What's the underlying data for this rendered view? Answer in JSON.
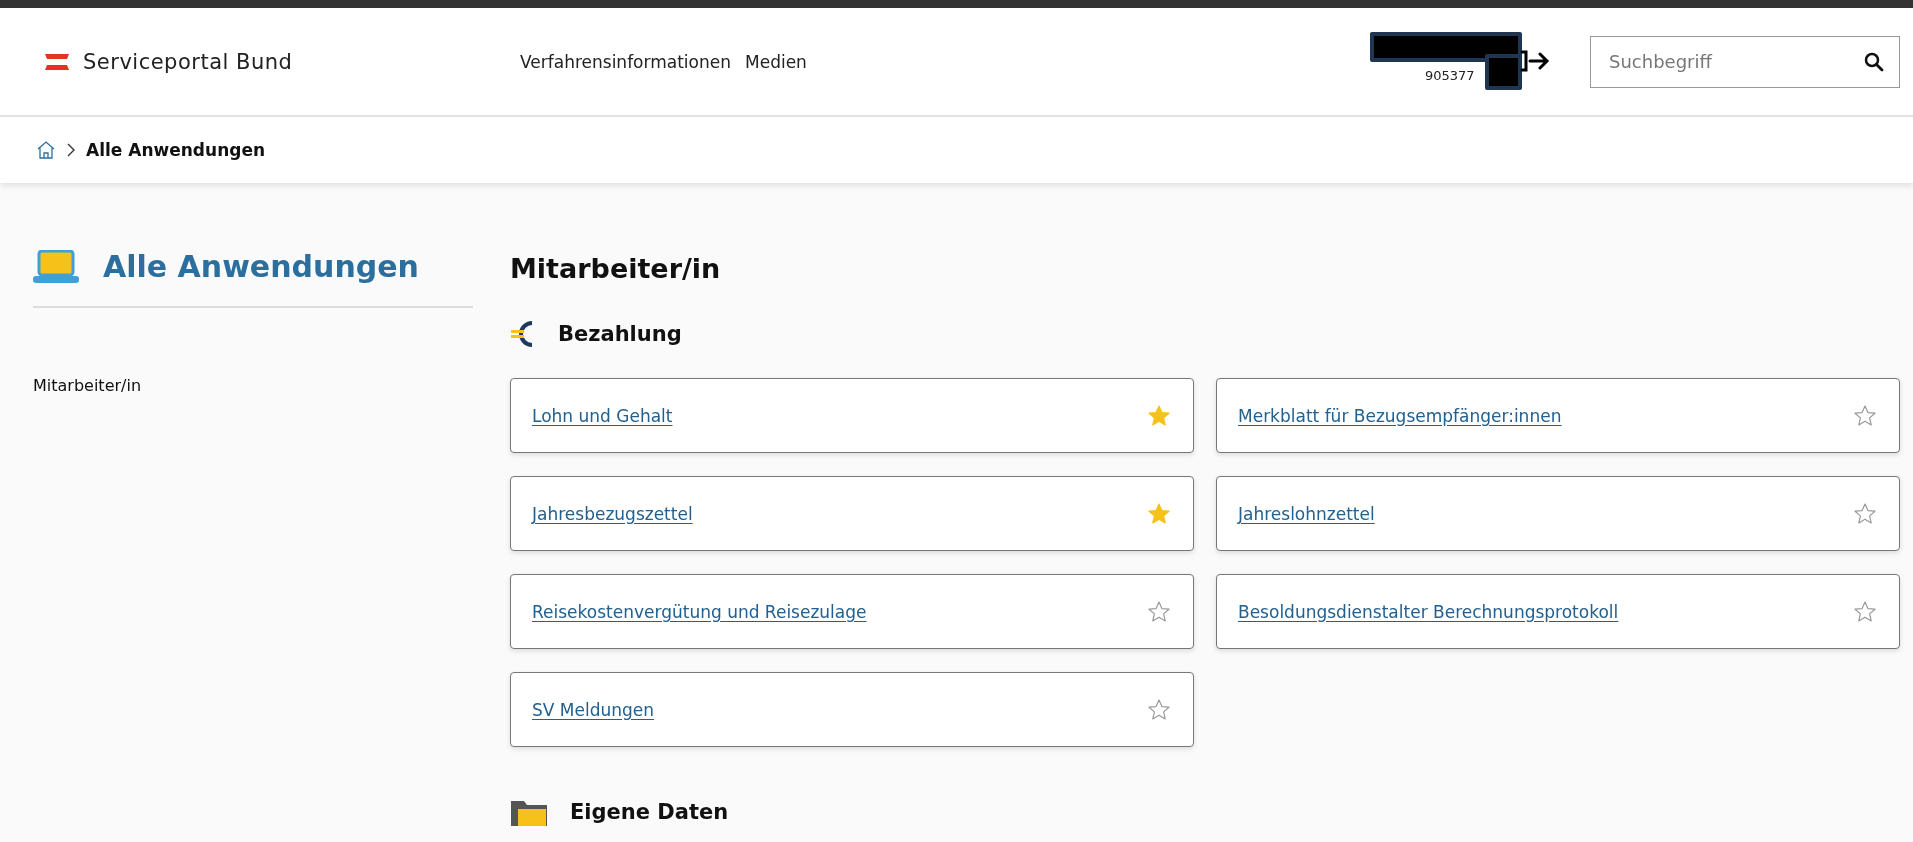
{
  "header": {
    "brand": "Serviceportal Bund",
    "nav": [
      "Verfahrensinformationen",
      "Medien"
    ],
    "account_number": "905377",
    "search": {
      "placeholder": "Suchbegriff"
    }
  },
  "breadcrumb": {
    "current": "Alle Anwendungen"
  },
  "sidebar": {
    "title": "Alle Anwendungen",
    "items": [
      {
        "label": "Mitarbeiter/in"
      }
    ]
  },
  "main": {
    "heading": "Mitarbeiter/in",
    "sections": [
      {
        "title": "Bezahlung",
        "kind": "euro",
        "apps": [
          {
            "label": "Lohn und Gehalt",
            "favorite": true
          },
          {
            "label": "Merkblatt für Bezugsempfänger:innen",
            "favorite": false
          },
          {
            "label": "Jahresbezugszettel",
            "favorite": true
          },
          {
            "label": "Jahreslohnzettel",
            "favorite": false
          },
          {
            "label": "Reisekostenvergütung und Reisezulage",
            "favorite": false
          },
          {
            "label": "Besoldungsdienstalter Berechnungsprotokoll",
            "favorite": false
          },
          {
            "label": "SV Meldungen",
            "favorite": false
          }
        ]
      },
      {
        "title": "Eigene Daten",
        "kind": "folder"
      }
    ]
  }
}
